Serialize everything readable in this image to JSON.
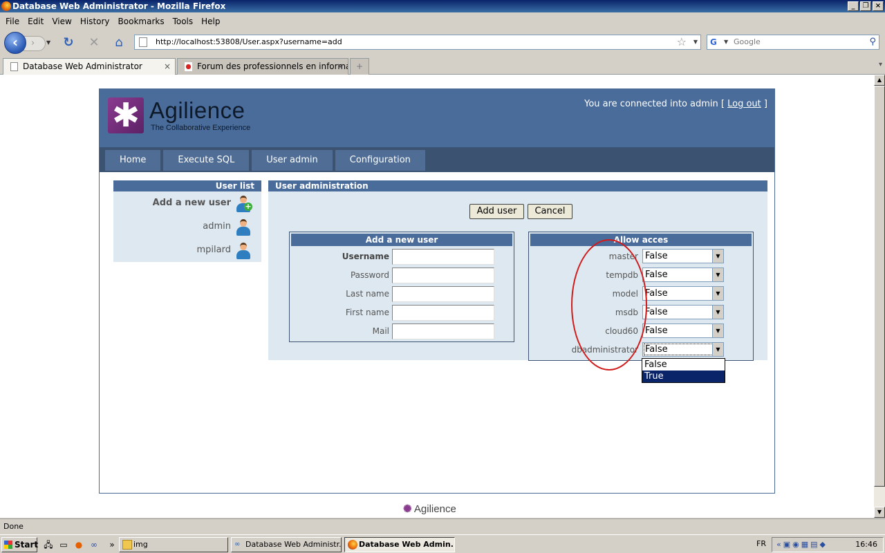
{
  "window": {
    "title": "Database Web Administrator - Mozilla Firefox"
  },
  "menubar": {
    "items": [
      "File",
      "Edit",
      "View",
      "History",
      "Bookmarks",
      "Tools",
      "Help"
    ]
  },
  "navbar": {
    "url": "http://localhost:53808/User.aspx?username=add",
    "search_placeholder": "Google"
  },
  "tabs": [
    {
      "label": "Database Web Administrator",
      "active": true
    },
    {
      "label": "Forum des professionnels en informatiq...",
      "active": false
    }
  ],
  "site": {
    "logo_name": "Agilience",
    "logo_tagline": "The Collaborative Experience",
    "connected_prefix": "You are connected into admin [ ",
    "logout_label": "Log out",
    "connected_suffix": " ]",
    "nav": [
      "Home",
      "Execute SQL",
      "User admin",
      "Configuration"
    ],
    "sidebar": {
      "title": "User list",
      "items": [
        "Add a new user",
        "admin",
        "mpilard"
      ]
    },
    "main": {
      "title": "User administration",
      "add_button": "Add user",
      "cancel_button": "Cancel",
      "new_user": {
        "title": "Add a new user",
        "fields": [
          "Username",
          "Password",
          "Last name",
          "First name",
          "Mail"
        ]
      },
      "access": {
        "title": "Allow acces",
        "databases": [
          "master",
          "tempdb",
          "model",
          "msdb",
          "cloud60",
          "dbadministrator"
        ],
        "value": "False"
      }
    },
    "dropdown_options": [
      "False",
      "True"
    ],
    "footer": "Agilience"
  },
  "status": {
    "text": "Done"
  },
  "taskbar": {
    "start": "Start",
    "buttons": [
      "img",
      "Database Web Administr...",
      "Database Web Admin..."
    ],
    "language": "FR",
    "clock": "16:46"
  },
  "colors": {
    "header": "#4a6c9b",
    "nav": "#3b5271",
    "panel": "#dde8f0",
    "annotation": "#d11a1a"
  }
}
